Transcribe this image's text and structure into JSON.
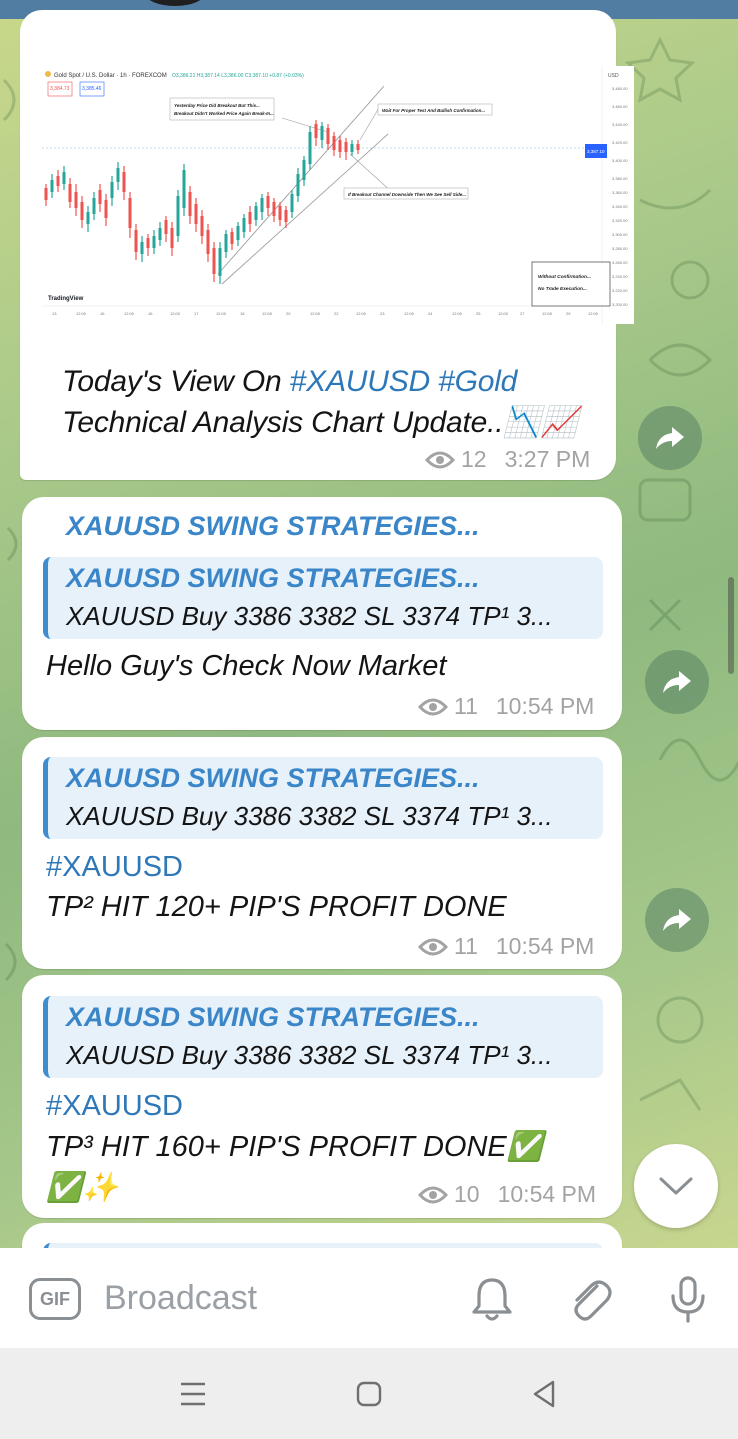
{
  "messages": [
    {
      "caption_line1_text": "Today's View On ",
      "caption_hashtags": "#XAUUSD #Gold",
      "caption_line2": "Technical Analysis Chart Update..📉📈",
      "views": "12",
      "time": "3:27 PM",
      "chart": {
        "header": "Gold Spot / U.S. Dollar · 1h · FOREXCOM",
        "sell_price": "3,384.73",
        "buy_price": "3,385.46",
        "ohlc": "O3,386.21 H3,387.14 L3,386.00 C3,387.10 +0.87 (+0.03%)",
        "currency": "USD",
        "brand": "TradingView",
        "annotation_1": "Yesterday Price Did Breakout But This...",
        "annotation_1b": "Breakout Didn't Worked Price Again Break-In...",
        "annotation_2": "Wait For Proper Test And Bullish Confirmation...",
        "annotation_3": "If Breakout Channel Downside Then We See Sell Side...",
        "box_line1": "Without Confirmation...",
        "box_line2": "No Trade Execution...",
        "price_label": "3,387.10",
        "y_ticks": [
          "3,480.00",
          "3,460.00",
          "3,440.00",
          "3,420.00",
          "3,400.00",
          "3,380.00",
          "3,360.00",
          "3,340.00",
          "3,320.00",
          "3,300.00",
          "3,280.00",
          "3,260.00",
          "3,240.00",
          "3,220.00",
          "3,200.00"
        ],
        "x_ticks": [
          "13",
          "12:00",
          "16",
          "12:00",
          "16",
          "12:00",
          "17",
          "12:00",
          "18",
          "12:00",
          "20",
          "12:00",
          "22",
          "12:00",
          "23",
          "12:00",
          "24",
          "12:00",
          "25",
          "12:00",
          "27",
          "12:00",
          "29",
          "12:00"
        ]
      }
    },
    {
      "sender": "XAUUSD SWING STRATEGIES...",
      "quote_title": "XAUUSD SWING STRATEGIES...",
      "quote_text": "XAUUSD Buy 3386 3382 SL   3374 TP¹ 3...",
      "text": "Hello Guy's Check Now Market",
      "views": "11",
      "time": "10:54 PM"
    },
    {
      "quote_title": "XAUUSD SWING STRATEGIES...",
      "quote_text": "XAUUSD Buy 3386 3382 SL   3374 TP¹ 3...",
      "hashtag": "#XAUUSD",
      "text": "TP² HIT 120+ PIP'S PROFIT DONE",
      "views": "11",
      "time": "10:54 PM"
    },
    {
      "quote_title": "XAUUSD SWING STRATEGIES...",
      "quote_text": "XAUUSD Buy 3386 3382 SL   3374 TP¹ 3...",
      "hashtag": "#XAUUSD",
      "text": "TP³ HIT 160+ PIP'S PROFIT DONE✅",
      "text_line2": "✅✨",
      "views": "10",
      "time": "10:54 PM"
    }
  ],
  "input": {
    "gif_label": "GIF",
    "placeholder": "Broadcast"
  },
  "icons": {
    "share": "share-arrow-icon",
    "scroll_down": "chevron-down-icon",
    "bell": "bell-icon",
    "attach": "paperclip-icon",
    "mic": "microphone-icon",
    "eye": "eye-icon",
    "nav_menu": "recent-apps-icon",
    "nav_home": "home-icon",
    "nav_back": "back-icon"
  },
  "colors": {
    "accent": "#3a86c8",
    "header": "#517da2",
    "bubble": "#ffffff",
    "quote_bg": "#e7f1fa",
    "muted": "#a3a3a3",
    "bull": "#26a69a",
    "bear": "#ef5350"
  }
}
